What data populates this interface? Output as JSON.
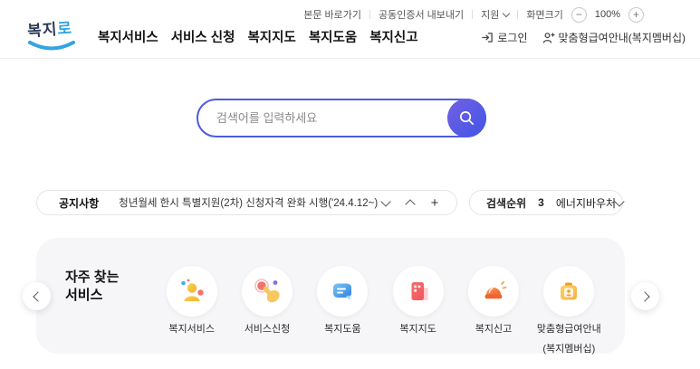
{
  "utility_bar": {
    "skip_link": "본문 바로가기",
    "cert_export": "공동인증서 내보내기",
    "support": "지원",
    "screen_size_label": "화면크기",
    "zoom_minus": "−",
    "zoom_level": "100%",
    "zoom_plus": "+"
  },
  "header": {
    "logo_part1": "복지",
    "logo_part2": "로",
    "nav": [
      {
        "label": "복지서비스"
      },
      {
        "label": "서비스 신청"
      },
      {
        "label": "복지지도"
      },
      {
        "label": "복지도움"
      },
      {
        "label": "복지신고"
      }
    ],
    "login_label": "로그인",
    "membership_label": "맞춤형급여안내(복지멤버십)"
  },
  "search": {
    "placeholder": "검색어를 입력하세요",
    "button_icon": "search-icon"
  },
  "notice": {
    "label": "공지사항",
    "text": "청년월세 한시 특별지원(2차) 신청자격 완화 시행('24.4.12~)",
    "controls": {
      "prev": "chevron-down-icon",
      "next": "chevron-up-icon",
      "expand": "+"
    }
  },
  "rank": {
    "label": "검색순위",
    "number": "3",
    "keyword": "에너지바우처"
  },
  "services": {
    "title_line1": "자주 찾는",
    "title_line2": "서비스",
    "items": [
      {
        "label": "복지서비스",
        "icon": "person-icon"
      },
      {
        "label": "서비스신청",
        "icon": "hand-click-icon"
      },
      {
        "label": "복지도움",
        "icon": "chat-bubble-icon"
      },
      {
        "label": "복지지도",
        "icon": "building-icon"
      },
      {
        "label": "복지신고",
        "icon": "siren-icon"
      },
      {
        "label": "맞춤형급여안내",
        "label2": "(복지멤버십)",
        "icon": "gift-badge-icon"
      }
    ]
  },
  "colors": {
    "accent_gradient_start": "#7460e2",
    "accent_gradient_end": "#3f56e8",
    "search_border": "#4c5be4",
    "logo_blue": "#35a3e2",
    "logo_navy": "#2b3a55",
    "carousel_bg": "#f6f6f8",
    "pill_border": "#e5e5e9"
  }
}
